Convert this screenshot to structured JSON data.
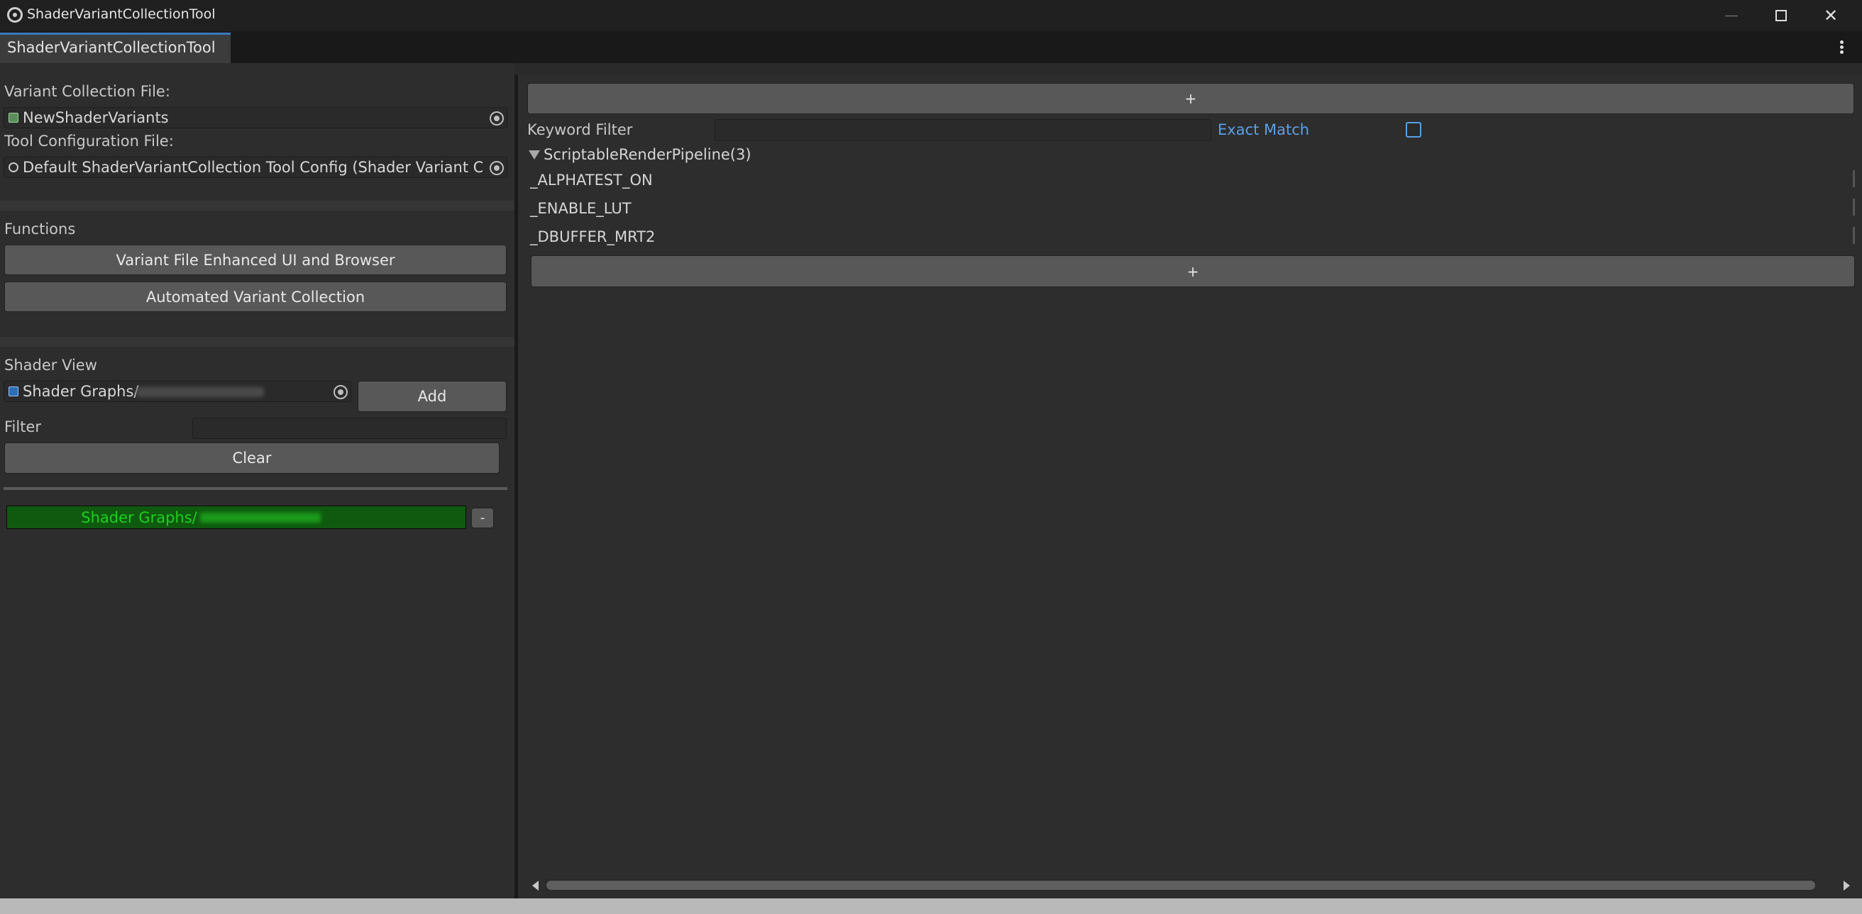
{
  "window": {
    "title": "ShaderVariantCollectionTool",
    "minimize_glyph": "",
    "maximize_glyph": "",
    "close_glyph": "✕"
  },
  "tab": {
    "label": "ShaderVariantCollectionTool"
  },
  "left": {
    "variant_collection_label": "Variant Collection File:",
    "variant_collection_value": "NewShaderVariants",
    "tool_config_label": "Tool Configuration File:",
    "tool_config_value": "Default ShaderVariantCollection Tool Config (Shader Variant Colle",
    "functions_label": "Functions",
    "enhanced_ui_button": "Variant File Enhanced UI and Browser",
    "automated_button": "Automated Variant Collection",
    "shader_view_label": "Shader View",
    "shader_field_value": "Shader Graphs/",
    "add_button": "Add",
    "filter_label": "Filter",
    "filter_value": "",
    "clear_button": "Clear",
    "shader_list_item": "Shader Graphs/",
    "remove_button": "-"
  },
  "right": {
    "add_top_button": "+",
    "keyword_filter_label": "Keyword Filter",
    "keyword_filter_value": "",
    "exact_match_label": "Exact Match",
    "exact_match_checked": false,
    "group_label": "ScriptableRenderPipeline(3)",
    "keywords": [
      "_ALPHATEST_ON",
      "_ENABLE_LUT",
      "_DBUFFER_MRT2"
    ],
    "add_bottom_button": "+"
  },
  "colors": {
    "accent": "#3a79bb",
    "link": "#5aa0e6",
    "list_item_bg": "#0f5a0f",
    "list_item_text": "#1fd01f"
  }
}
